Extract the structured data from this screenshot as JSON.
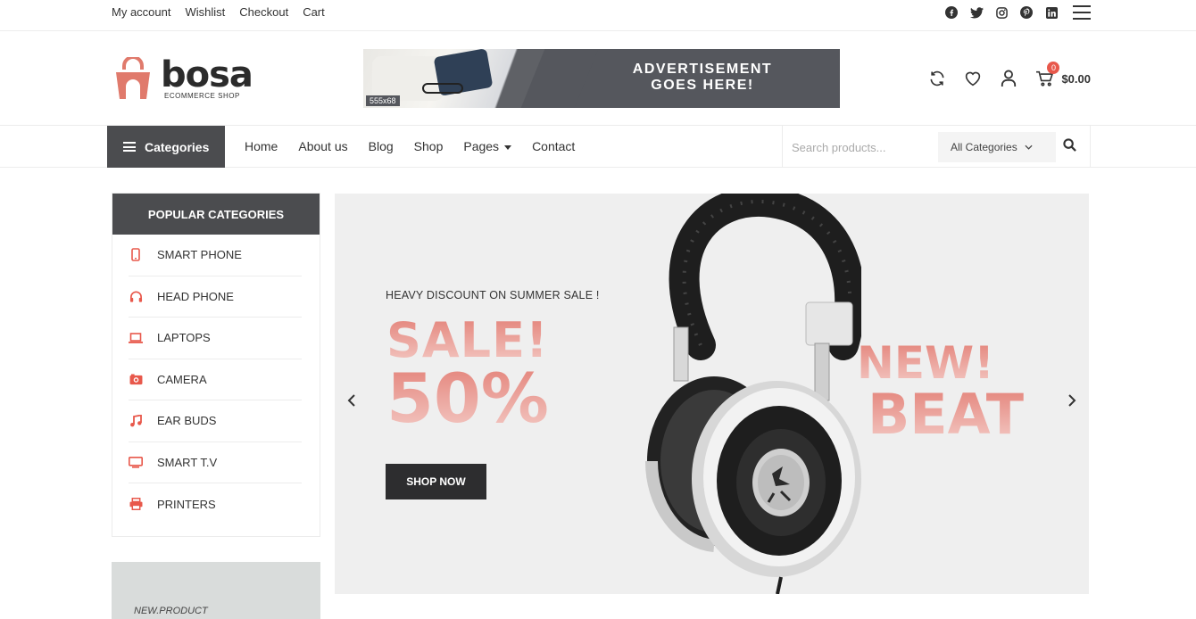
{
  "topbar": {
    "links": [
      "My account",
      "Wishlist",
      "Checkout",
      "Cart"
    ],
    "social_icons": [
      "facebook-icon",
      "twitter-icon",
      "instagram-icon",
      "pinterest-icon",
      "linkedin-icon"
    ]
  },
  "header": {
    "logo_word": "bosa",
    "logo_sub": "ECOMMERCE SHOP",
    "ad_size": "555x68",
    "ad_line1": "ADVERTISEMENT",
    "ad_line2": "GOES HERE!",
    "cart_count": "0",
    "cart_total": "$0.00"
  },
  "nav": {
    "categories_label": "Categories",
    "menu": [
      "Home",
      "About us",
      "Blog",
      "Shop",
      "Pages",
      "Contact"
    ],
    "search_placeholder": "Search products...",
    "category_select": "All Categories"
  },
  "sidebar": {
    "title": "POPULAR CATEGORIES",
    "items": [
      {
        "label": "SMART PHONE",
        "icon": "smartphone-icon"
      },
      {
        "label": "HEAD PHONE",
        "icon": "headphone-icon"
      },
      {
        "label": "LAPTOPS",
        "icon": "laptop-icon"
      },
      {
        "label": "CAMERA",
        "icon": "camera-icon"
      },
      {
        "label": "EAR BUDS",
        "icon": "music-note-icon"
      },
      {
        "label": "SMART T.V",
        "icon": "tv-icon"
      },
      {
        "label": "PRINTERS",
        "icon": "printer-icon"
      }
    ],
    "promo_label": "NEW.PRODUCT"
  },
  "hero": {
    "eyebrow": "HEAVY DISCOUNT ON SUMMER SALE !",
    "sale": "SALE!",
    "percent": "50%",
    "button": "SHOP NOW",
    "new": "NEW!",
    "beat": "BEAT"
  },
  "colors": {
    "accent": "#e8584b",
    "dark": "#4b4c4f",
    "hero_bg": "#efefef"
  }
}
